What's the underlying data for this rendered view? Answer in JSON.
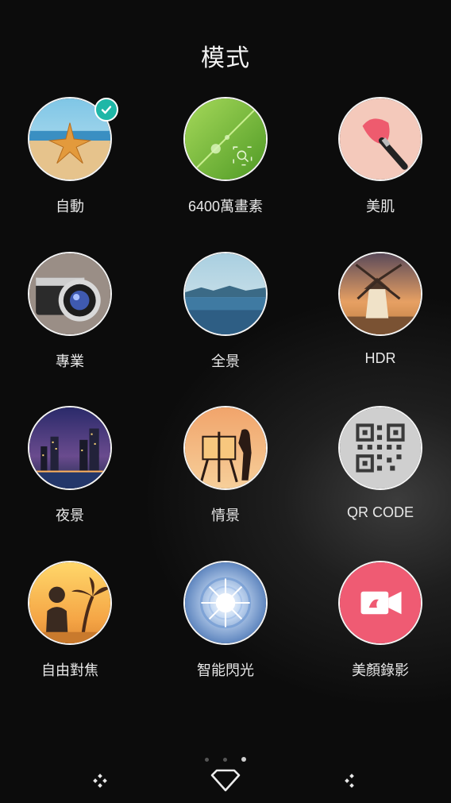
{
  "header": {
    "title": "模式"
  },
  "modes": [
    {
      "label": "自動",
      "icon": "starfish-beach-icon",
      "selected": true
    },
    {
      "label": "6400萬畫素",
      "icon": "leaf-macro-icon"
    },
    {
      "label": "美肌",
      "icon": "makeup-brush-icon"
    },
    {
      "label": "專業",
      "icon": "pro-camera-icon"
    },
    {
      "label": "全景",
      "icon": "panorama-lake-icon"
    },
    {
      "label": "HDR",
      "icon": "windmill-icon"
    },
    {
      "label": "夜景",
      "icon": "night-city-icon"
    },
    {
      "label": "情景",
      "icon": "painter-easel-icon"
    },
    {
      "label": "QR CODE",
      "icon": "qr-code-icon"
    },
    {
      "label": "自由對焦",
      "icon": "palm-tree-portrait-icon"
    },
    {
      "label": "智能閃光",
      "icon": "smart-flash-icon"
    },
    {
      "label": "美顏錄影",
      "icon": "video-camera-icon"
    }
  ],
  "pager": {
    "pages": 3,
    "current": 3
  },
  "navbar": {
    "left": "left-nav-icon",
    "center": "home-diamond-icon",
    "right": "right-nav-icon"
  },
  "colors": {
    "accent": "#1fb7a7",
    "background": "#0c0c0c"
  }
}
